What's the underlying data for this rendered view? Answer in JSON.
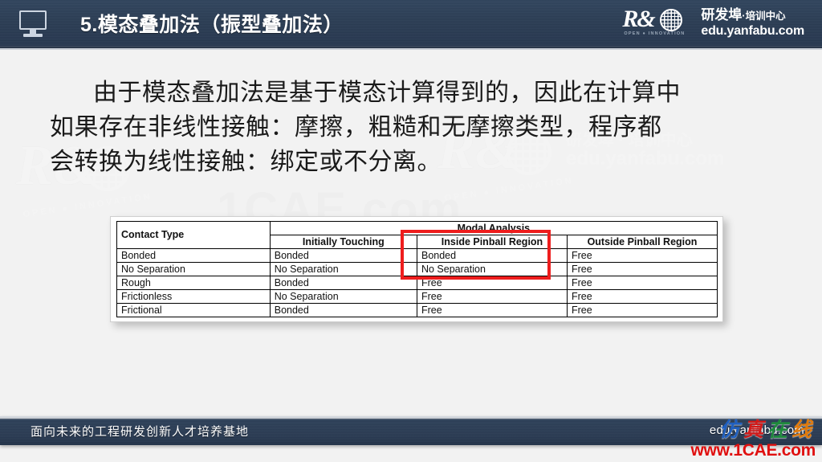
{
  "header": {
    "icon": "monitor-icon",
    "title": "5.模态叠加法（振型叠加法）",
    "logo": {
      "mark": "R&",
      "globe_icon": "globe-icon",
      "tagline": "OPEN  ●  INNOVATION",
      "cn_name": "研发埠",
      "cn_sep": "·",
      "cn_sub": "培训中心",
      "url": "edu.yanfabu.com"
    }
  },
  "body": {
    "paragraph_lines": [
      "由于模态叠加法是基于模态计算得到的，因此在计算中",
      "如果存在非线性接触：摩擦，粗糙和无摩擦类型，程序都",
      "会转换为线性接触：绑定或不分离。"
    ],
    "watermark_1cae": "1CAE.com",
    "watermark_rd_mark": "R&",
    "watermark_rd_tag": "OPEN  ●  INNOVATION",
    "watermark_cn": "研发埠 · 培训中心",
    "watermark_url": "edu.yanfabu.com"
  },
  "table": {
    "group_header": "Modal Analysis",
    "row_header": "Contact Type",
    "columns": [
      "Initially Touching",
      "Inside Pinball Region",
      "Outside Pinball Region"
    ],
    "rows": [
      {
        "contact_type": "Bonded",
        "initially_touching": "Bonded",
        "inside_pinball": "Bonded",
        "outside_pinball": "Free"
      },
      {
        "contact_type": "No Separation",
        "initially_touching": "No Separation",
        "inside_pinball": "No Separation",
        "outside_pinball": "Free"
      },
      {
        "contact_type": "Rough",
        "initially_touching": "Bonded",
        "inside_pinball": "Free",
        "outside_pinball": "Free"
      },
      {
        "contact_type": "Frictionless",
        "initially_touching": "No Separation",
        "inside_pinball": "Free",
        "outside_pinball": "Free"
      },
      {
        "contact_type": "Frictional",
        "initially_touching": "Bonded",
        "inside_pinball": "Free",
        "outside_pinball": "Free"
      }
    ],
    "highlight_color": "#ee1d1d"
  },
  "footer": {
    "left_text": "面向未来的工程研发创新人才培养基地",
    "right_text": "edu.yanfabu.com",
    "watermark": {
      "cn1": "仿",
      "cn2": "真",
      "cn3": "在",
      "cn4": "线",
      "url": "www.1CAE.com"
    }
  },
  "colors": {
    "header_navy": "#2b3d54",
    "footer_navy": "#2a3b53",
    "stage_bg": "#f2f2f2",
    "highlight_red": "#ee1d1d",
    "watermark_red": "#e01010"
  }
}
